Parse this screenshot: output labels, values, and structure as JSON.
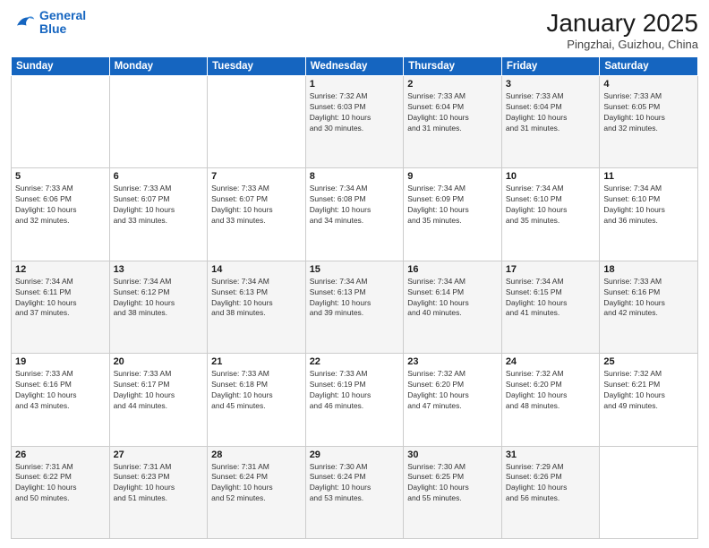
{
  "header": {
    "logo_line1": "General",
    "logo_line2": "Blue",
    "month": "January 2025",
    "location": "Pingzhai, Guizhou, China"
  },
  "weekdays": [
    "Sunday",
    "Monday",
    "Tuesday",
    "Wednesday",
    "Thursday",
    "Friday",
    "Saturday"
  ],
  "weeks": [
    [
      {
        "day": "",
        "info": ""
      },
      {
        "day": "",
        "info": ""
      },
      {
        "day": "",
        "info": ""
      },
      {
        "day": "1",
        "info": "Sunrise: 7:32 AM\nSunset: 6:03 PM\nDaylight: 10 hours\nand 30 minutes."
      },
      {
        "day": "2",
        "info": "Sunrise: 7:33 AM\nSunset: 6:04 PM\nDaylight: 10 hours\nand 31 minutes."
      },
      {
        "day": "3",
        "info": "Sunrise: 7:33 AM\nSunset: 6:04 PM\nDaylight: 10 hours\nand 31 minutes."
      },
      {
        "day": "4",
        "info": "Sunrise: 7:33 AM\nSunset: 6:05 PM\nDaylight: 10 hours\nand 32 minutes."
      }
    ],
    [
      {
        "day": "5",
        "info": "Sunrise: 7:33 AM\nSunset: 6:06 PM\nDaylight: 10 hours\nand 32 minutes."
      },
      {
        "day": "6",
        "info": "Sunrise: 7:33 AM\nSunset: 6:07 PM\nDaylight: 10 hours\nand 33 minutes."
      },
      {
        "day": "7",
        "info": "Sunrise: 7:33 AM\nSunset: 6:07 PM\nDaylight: 10 hours\nand 33 minutes."
      },
      {
        "day": "8",
        "info": "Sunrise: 7:34 AM\nSunset: 6:08 PM\nDaylight: 10 hours\nand 34 minutes."
      },
      {
        "day": "9",
        "info": "Sunrise: 7:34 AM\nSunset: 6:09 PM\nDaylight: 10 hours\nand 35 minutes."
      },
      {
        "day": "10",
        "info": "Sunrise: 7:34 AM\nSunset: 6:10 PM\nDaylight: 10 hours\nand 35 minutes."
      },
      {
        "day": "11",
        "info": "Sunrise: 7:34 AM\nSunset: 6:10 PM\nDaylight: 10 hours\nand 36 minutes."
      }
    ],
    [
      {
        "day": "12",
        "info": "Sunrise: 7:34 AM\nSunset: 6:11 PM\nDaylight: 10 hours\nand 37 minutes."
      },
      {
        "day": "13",
        "info": "Sunrise: 7:34 AM\nSunset: 6:12 PM\nDaylight: 10 hours\nand 38 minutes."
      },
      {
        "day": "14",
        "info": "Sunrise: 7:34 AM\nSunset: 6:13 PM\nDaylight: 10 hours\nand 38 minutes."
      },
      {
        "day": "15",
        "info": "Sunrise: 7:34 AM\nSunset: 6:13 PM\nDaylight: 10 hours\nand 39 minutes."
      },
      {
        "day": "16",
        "info": "Sunrise: 7:34 AM\nSunset: 6:14 PM\nDaylight: 10 hours\nand 40 minutes."
      },
      {
        "day": "17",
        "info": "Sunrise: 7:34 AM\nSunset: 6:15 PM\nDaylight: 10 hours\nand 41 minutes."
      },
      {
        "day": "18",
        "info": "Sunrise: 7:33 AM\nSunset: 6:16 PM\nDaylight: 10 hours\nand 42 minutes."
      }
    ],
    [
      {
        "day": "19",
        "info": "Sunrise: 7:33 AM\nSunset: 6:16 PM\nDaylight: 10 hours\nand 43 minutes."
      },
      {
        "day": "20",
        "info": "Sunrise: 7:33 AM\nSunset: 6:17 PM\nDaylight: 10 hours\nand 44 minutes."
      },
      {
        "day": "21",
        "info": "Sunrise: 7:33 AM\nSunset: 6:18 PM\nDaylight: 10 hours\nand 45 minutes."
      },
      {
        "day": "22",
        "info": "Sunrise: 7:33 AM\nSunset: 6:19 PM\nDaylight: 10 hours\nand 46 minutes."
      },
      {
        "day": "23",
        "info": "Sunrise: 7:32 AM\nSunset: 6:20 PM\nDaylight: 10 hours\nand 47 minutes."
      },
      {
        "day": "24",
        "info": "Sunrise: 7:32 AM\nSunset: 6:20 PM\nDaylight: 10 hours\nand 48 minutes."
      },
      {
        "day": "25",
        "info": "Sunrise: 7:32 AM\nSunset: 6:21 PM\nDaylight: 10 hours\nand 49 minutes."
      }
    ],
    [
      {
        "day": "26",
        "info": "Sunrise: 7:31 AM\nSunset: 6:22 PM\nDaylight: 10 hours\nand 50 minutes."
      },
      {
        "day": "27",
        "info": "Sunrise: 7:31 AM\nSunset: 6:23 PM\nDaylight: 10 hours\nand 51 minutes."
      },
      {
        "day": "28",
        "info": "Sunrise: 7:31 AM\nSunset: 6:24 PM\nDaylight: 10 hours\nand 52 minutes."
      },
      {
        "day": "29",
        "info": "Sunrise: 7:30 AM\nSunset: 6:24 PM\nDaylight: 10 hours\nand 53 minutes."
      },
      {
        "day": "30",
        "info": "Sunrise: 7:30 AM\nSunset: 6:25 PM\nDaylight: 10 hours\nand 55 minutes."
      },
      {
        "day": "31",
        "info": "Sunrise: 7:29 AM\nSunset: 6:26 PM\nDaylight: 10 hours\nand 56 minutes."
      },
      {
        "day": "",
        "info": ""
      }
    ]
  ]
}
